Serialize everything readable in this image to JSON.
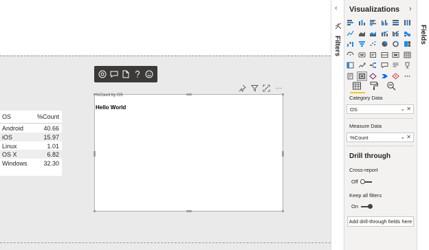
{
  "table": {
    "headers": [
      "OS",
      "%Count"
    ],
    "rows": [
      {
        "os": "Android",
        "count": "40.66"
      },
      {
        "os": "iOS",
        "count": "15.97"
      },
      {
        "os": "Linux",
        "count": "1.01"
      },
      {
        "os": "OS X",
        "count": "6.82"
      },
      {
        "os": "Windows",
        "count": "32.30"
      }
    ]
  },
  "visual": {
    "title": "%Count by OS",
    "content": "Hello World"
  },
  "floating_toolbar": {
    "icons": [
      "target-icon",
      "comment-icon",
      "document-icon",
      "help-icon",
      "smiley-icon"
    ]
  },
  "visual_header": {
    "icons": [
      "pin-icon",
      "filter-icon",
      "focus-mode-icon",
      "more-options-icon"
    ],
    "more_label": "···"
  },
  "filters_pane": {
    "label": "Filters",
    "collapse_glyph": "‹"
  },
  "visualizations_pane": {
    "title": "Visualizations",
    "expand_glyph": "›",
    "fields_label": "Category Data",
    "category_well": "OS",
    "measure_label": "Measure Data",
    "measure_well": "%Count",
    "well_controls": "⌄ ✕",
    "drill_title": "Drill through",
    "cross_report_label": "Cross-report",
    "cross_report_state": "Off",
    "keep_filters_label": "Keep all filters",
    "keep_filters_state": "On",
    "add_drill_label": "Add drill-through fields here"
  },
  "fields_pane": {
    "label": "Fields"
  },
  "colors": {
    "accent": "#f2c811",
    "toolbar_bg": "#3b3a39",
    "pane_bg": "#f3f2f1"
  }
}
